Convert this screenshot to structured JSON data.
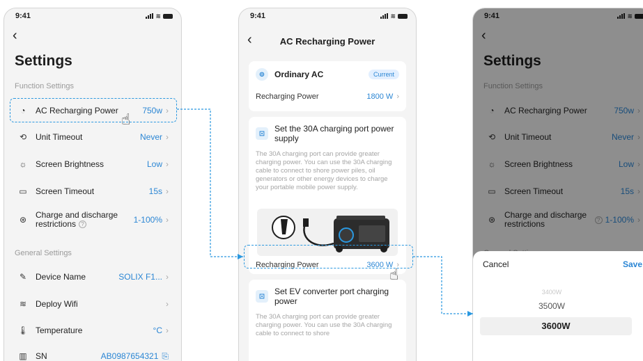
{
  "status": {
    "time": "9:41"
  },
  "screen1": {
    "title": "Settings",
    "sections": {
      "function": "Function Settings",
      "general": "General Settings"
    },
    "rows": [
      {
        "label": "AC Recharging Power",
        "value": "750w"
      },
      {
        "label": "Unit Timeout",
        "value": "Never"
      },
      {
        "label": "Screen Brightness",
        "value": "Low"
      },
      {
        "label": "Screen Timeout",
        "value": "15s"
      },
      {
        "label": "Charge and discharge restrictions",
        "value": "1-100%"
      },
      {
        "label": "Device Name",
        "value": "SOLIX F1..."
      },
      {
        "label": "Deploy Wifi",
        "value": ""
      },
      {
        "label": "Temperature",
        "value": "°C"
      },
      {
        "label": "SN",
        "value": "AB0987654321"
      }
    ]
  },
  "screen2": {
    "title": "AC Recharging Power",
    "ordinary": {
      "title": "Ordinary AC",
      "badge": "Current",
      "row_label": "Recharging Power",
      "row_value": "1800 W"
    },
    "port30": {
      "title": "Set the 30A charging port power supply",
      "desc": "The 30A charging port can provide greater charging power. You can use the 30A charging cable to connect to shore power piles, oil generators or other energy devices to charge your portable mobile power supply.",
      "row_label": "Recharging Power",
      "row_value": "3600 W"
    },
    "ev": {
      "title": "Set EV converter port charging power",
      "desc": "The 30A charging port can provide greater charging power. You can use the 30A charging cable to connect to shore"
    }
  },
  "screen3": {
    "title": "Settings",
    "sections": {
      "function": "Function Settings",
      "general": "General Settings"
    },
    "rows": [
      {
        "label": "AC Recharging Power",
        "value": "750w"
      },
      {
        "label": "Unit Timeout",
        "value": "Never"
      },
      {
        "label": "Screen Brightness",
        "value": "Low"
      },
      {
        "label": "Screen Timeout",
        "value": "15s"
      },
      {
        "label": "Charge and discharge restrictions",
        "value": "1-100%"
      }
    ],
    "sheet": {
      "cancel": "Cancel",
      "save": "Save",
      "options": [
        "3400W",
        "3500W",
        "3600W"
      ]
    }
  },
  "colors": {
    "accent": "#2b86d4",
    "highlight": "#2a98e0"
  }
}
